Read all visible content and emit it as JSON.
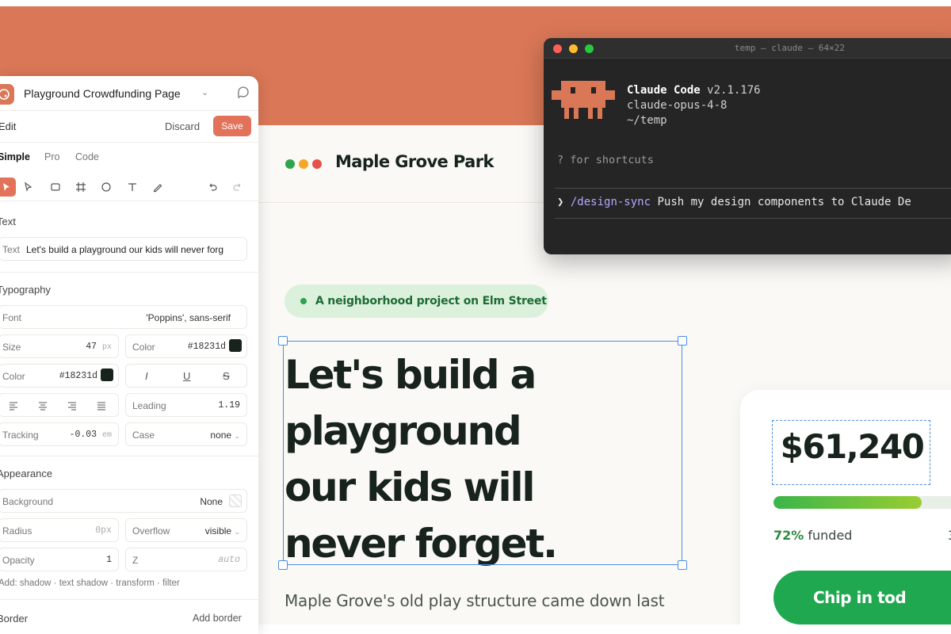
{
  "colors": {
    "brand": "#d97757",
    "ink": "#18231d",
    "accent_green": "#1fa84f",
    "selection_blue": "#4a8fe0",
    "logo_dots": [
      "#2ea44f",
      "#f5a623",
      "#e5544b"
    ]
  },
  "page": {
    "site_title": "Maple Grove Park",
    "pill_text": "A neighborhood project on Elm Street",
    "headline": [
      "Let's build a",
      "playground",
      "our kids will",
      "never forget."
    ],
    "lead": "Maple Grove's old play structure came down last",
    "fund": {
      "amount": "$61,240",
      "progress_fraction": 0.72,
      "funded_pct": "72%",
      "funded_label": " funded",
      "edge_char": "3",
      "cta": "Chip in tod"
    }
  },
  "terminal": {
    "title": "temp — claude — 64×22",
    "app_name": "Claude Code",
    "version": "v2.1.176",
    "model": "claude-opus-4-8",
    "cwd": "~/temp",
    "shortcuts": "? for shortcuts",
    "prompt_symbol": "❯",
    "command": "/design-sync",
    "command_text": "Push my design components to Claude De"
  },
  "editor": {
    "project_name": "Playground Crowdfunding Page",
    "edit_label": "Edit",
    "discard": "Discard",
    "save": "Save",
    "tabs": [
      "Simple",
      "Pro",
      "Code"
    ],
    "sections": {
      "text": "Text",
      "typography": "Typography",
      "appearance": "Appearance",
      "border": "Border"
    },
    "text_field_label": "Text",
    "text_field_value": "Let's build a playground our kids will never forg",
    "typography": {
      "font_label": "Font",
      "font_value": "'Poppins', sans-serif",
      "size_label": "Size",
      "size_value": "47",
      "size_unit": "px",
      "color_label": "Color",
      "color_value": "#18231d",
      "color2_label": "Color",
      "color2_value": "#18231d",
      "italic": "I",
      "underline": "U",
      "strike": "S",
      "leading_label": "Leading",
      "leading_value": "1.19",
      "tracking_label": "Tracking",
      "tracking_value": "-0.03",
      "tracking_unit": "em",
      "case_label": "Case",
      "case_value": "none"
    },
    "appearance": {
      "background_label": "Background",
      "background_value": "None",
      "radius_label": "Radius",
      "radius_value": "0px",
      "overflow_label": "Overflow",
      "overflow_value": "visible",
      "opacity_label": "Opacity",
      "opacity_value": "1",
      "z_label": "Z",
      "z_value": "auto"
    },
    "add_line": "Add: shadow · text shadow · transform · filter",
    "add_border": "Add border"
  }
}
